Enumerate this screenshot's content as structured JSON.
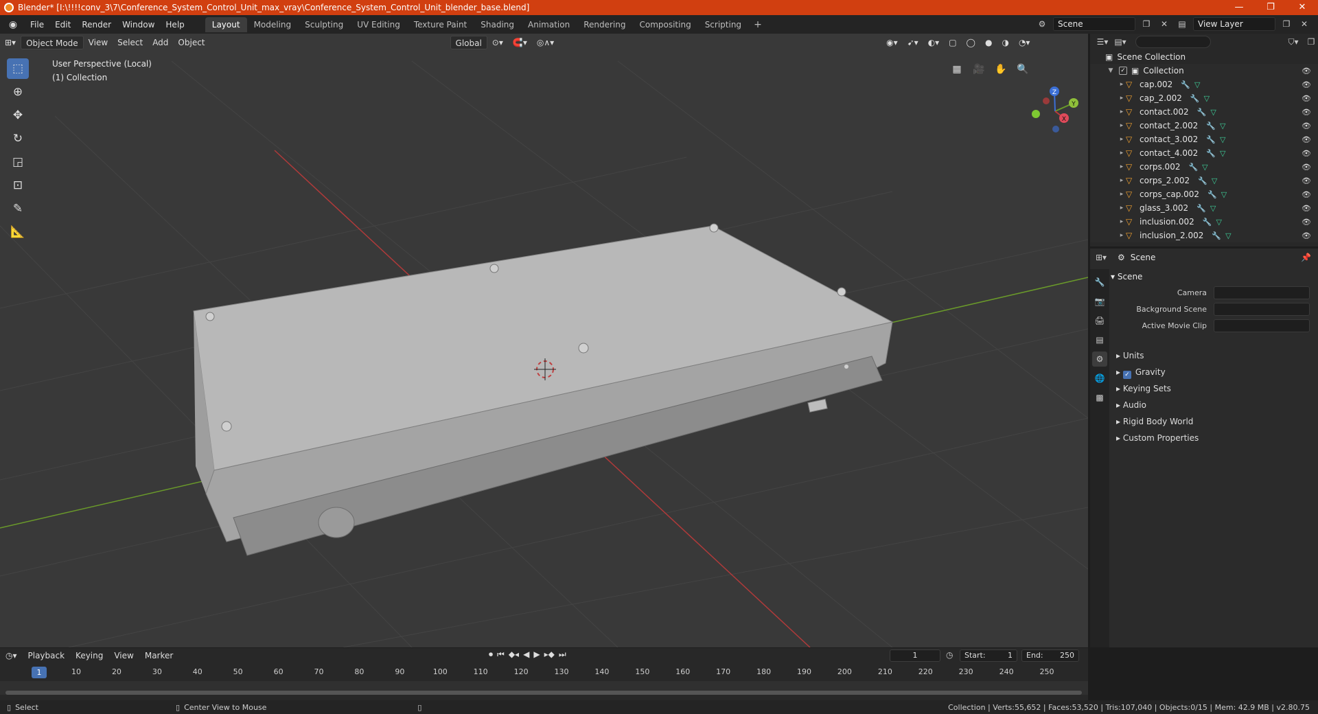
{
  "window": {
    "title": "Blender* [I:\\!!!!conv_3\\7\\Conference_System_Control_Unit_max_vray\\Conference_System_Control_Unit_blender_base.blend]",
    "minimize": "—",
    "maximize": "❐",
    "close": "✕"
  },
  "menu": [
    "File",
    "Edit",
    "Render",
    "Window",
    "Help"
  ],
  "workspaces": [
    "Layout",
    "Modeling",
    "Sculpting",
    "UV Editing",
    "Texture Paint",
    "Shading",
    "Animation",
    "Rendering",
    "Compositing",
    "Scripting"
  ],
  "scene_selector": "Scene",
  "view_layer": "View Layer",
  "viewport": {
    "mode": "Object Mode",
    "menus": [
      "View",
      "Select",
      "Add",
      "Object"
    ],
    "transform": "Global",
    "info_line1": "User Perspective (Local)",
    "info_line2": "(1) Collection",
    "gizmo_x": "X",
    "gizmo_y": "Y",
    "gizmo_z": "Z"
  },
  "outliner": {
    "root": "Scene Collection",
    "collection": "Collection",
    "items": [
      "cap.002",
      "cap_2.002",
      "contact.002",
      "contact_2.002",
      "contact_3.002",
      "contact_4.002",
      "corps.002",
      "corps_2.002",
      "corps_cap.002",
      "glass_3.002",
      "inclusion.002",
      "inclusion_2.002"
    ]
  },
  "properties": {
    "header": "Scene",
    "panel_title": "Scene",
    "camera_label": "Camera",
    "background_scene_label": "Background Scene",
    "active_movie_clip_label": "Active Movie Clip",
    "subpanels": [
      "Units",
      "Gravity",
      "Keying Sets",
      "Audio",
      "Rigid Body World",
      "Custom Properties"
    ],
    "gravity_checked": true
  },
  "timeline": {
    "menus": [
      "Playback",
      "Keying",
      "View",
      "Marker"
    ],
    "current_frame": "1",
    "start_label": "Start:",
    "start": "1",
    "end_label": "End:",
    "end": "250",
    "ticks": [
      "1",
      "10",
      "20",
      "30",
      "40",
      "50",
      "60",
      "70",
      "80",
      "90",
      "100",
      "110",
      "120",
      "130",
      "140",
      "150",
      "160",
      "170",
      "180",
      "190",
      "200",
      "210",
      "220",
      "230",
      "240",
      "250"
    ]
  },
  "status": {
    "left1": "Select",
    "left2": "Center View to Mouse",
    "right": "Collection | Verts:55,652 | Faces:53,520 | Tris:107,040 | Objects:0/15 | Mem: 42.9 MB | v2.80.75"
  },
  "colors": {
    "title_bg": "#d13f10",
    "accent": "#4772b3",
    "axis_x": "#b03a3a",
    "axis_y": "#6a9a2a"
  }
}
